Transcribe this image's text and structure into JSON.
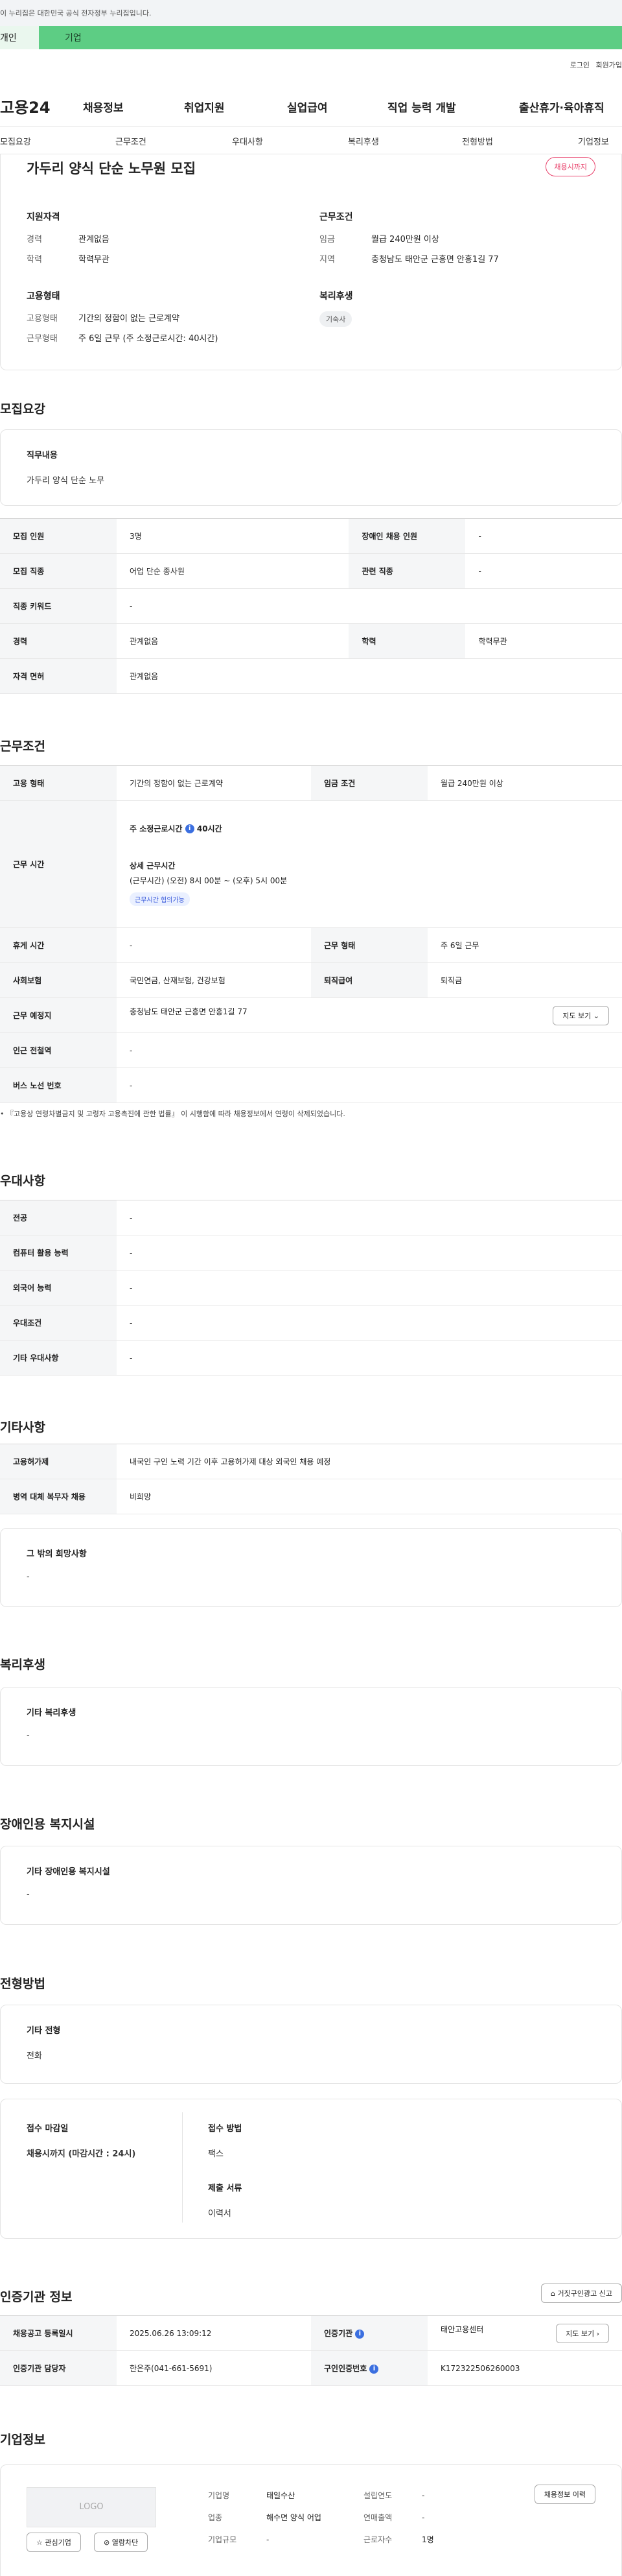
{
  "notice": "이 누리집은 대한민국 공식 전자정부 누리집입니다.",
  "tabs": {
    "personal": "개인",
    "company": "기업"
  },
  "util": {
    "login": "로그인",
    "join": "회원가입"
  },
  "gnb": {
    "logo": "고용24",
    "menu": [
      "채용정보",
      "취업지원",
      "실업급여",
      "직업 능력 개발",
      "출산휴가·육아휴직"
    ]
  },
  "subnav": [
    "모집요강",
    "근무조건",
    "우대사항",
    "복리후생",
    "전형방법",
    "기업정보"
  ],
  "header": {
    "title": "가두리 양식 단순 노무원 모집",
    "badge": "채용시까지",
    "qual_title": "지원자격",
    "qual": [
      {
        "k": "경력",
        "v": "관계없음"
      },
      {
        "k": "학력",
        "v": "학력무관"
      }
    ],
    "cond_title": "근무조건",
    "cond": [
      {
        "k": "임금",
        "v": "월급 240만원 이상"
      },
      {
        "k": "지역",
        "v": "충청남도 태안군 근흥면 안흥1길 77"
      }
    ],
    "emp_title": "고용형태",
    "emp": [
      {
        "k": "고용형태",
        "v": "기간의 정함이 없는 근로계약"
      },
      {
        "k": "근무형태",
        "v": "주 6일 근무 (주 소정근로시간: 40시간)"
      }
    ],
    "welfare_title": "복리후생",
    "welfare_tag": "기숙사"
  },
  "recruit": {
    "title": "모집요강",
    "duty_label": "직무내용",
    "duty": "가두리 양식 단순 노무",
    "rows": [
      {
        "k1": "모집 인원",
        "v1": "3명",
        "k2": "장애인 채용 인원",
        "v2": "-"
      },
      {
        "k1": "모집 직종",
        "v1": "어업 단순 종사원",
        "k2": "관련 직종",
        "v2": "-"
      },
      {
        "k1": "직종 키워드",
        "v1": "-"
      },
      {
        "k1": "경력",
        "v1": "관계없음",
        "k2": "학력",
        "v2": "학력무관"
      },
      {
        "k1": "자격 면허",
        "v1": "관계없음"
      }
    ]
  },
  "work": {
    "title": "근무조건",
    "emp_k": "고용 형태",
    "emp_v": "기간의 정함이 없는 근로계약",
    "wage_k": "임금 조건",
    "wage_v": "월급 240만원 이상",
    "time_k": "근무 시간",
    "std": "주 소정근로시간",
    "std_v": "40시간",
    "detail_t": "상세 근무시간",
    "detail_v": "(근무시간) (오전) 8시 00분 ~ (오후) 5시 00분",
    "chip": "근무시간 협의가능",
    "rest_k": "휴게 시간",
    "rest_v": "-",
    "form_k": "근무 형태",
    "form_v": "주 6일 근무",
    "ins_k": "사회보험",
    "ins_v": "국민연금, 산재보험, 건강보험",
    "ret_k": "퇴직급여",
    "ret_v": "퇴직금",
    "place_k": "근무 예정지",
    "place_v": "충청남도 태안군 근흥면 안흥1길 77",
    "map_btn": "지도 보기",
    "sub_k": "인근 전철역",
    "sub_v": "-",
    "bus_k": "버스 노선 번호",
    "bus_v": "-",
    "note": "『고용상 연령차별금지 및 고령자 고용촉진에 관한 법률』 이 시행함에 따라 채용정보에서 연령이 삭제되었습니다."
  },
  "pref": {
    "title": "우대사항",
    "rows": [
      {
        "k": "전공",
        "v": "-"
      },
      {
        "k": "컴퓨터 활용 능력",
        "v": "-"
      },
      {
        "k": "외국어 능력",
        "v": "-"
      },
      {
        "k": "우대조건",
        "v": "-"
      },
      {
        "k": "기타 우대사항",
        "v": "-"
      }
    ]
  },
  "etc": {
    "title": "기타사항",
    "rows": [
      {
        "k": "고용허가제",
        "v": "내국인 구인 노력 기간 이후 고용허가제 대상 외국인 채용 예정"
      },
      {
        "k": "병역 대체 복무자 채용",
        "v": "비희망"
      }
    ],
    "other_label": "그 밖의 희망사항",
    "other_v": "-"
  },
  "welfare": {
    "title": "복리후생",
    "label": "기타 복리후생",
    "v": "-"
  },
  "disab": {
    "title": "장애인용 복지시설",
    "label": "기타 장애인용 복지시설",
    "v": "-"
  },
  "select": {
    "title": "전형방법",
    "label": "기타 전형",
    "v": "전화",
    "deadline_t": "접수 마감일",
    "deadline_v": "채용시까지 (마감시간 : 24시)",
    "method_t": "접수 방법",
    "method_v": "팩스",
    "docs_t": "제출 서류",
    "docs_v": "이력서"
  },
  "agency": {
    "title": "인증기관 정보",
    "report_btn": "거짓구인광고 신고",
    "reg_k": "채용공고 등록일시",
    "reg_v": "2025.06.26 13:09:12",
    "org_k": "인증기관",
    "org_v": "태안고용센터",
    "map_btn": "지도 보기",
    "staff_k": "인증기관 담당자",
    "staff_v": "한은주(041-661-5691)",
    "no_k": "구인인증번호",
    "no_v": "K172322506260003"
  },
  "company": {
    "title": "기업정보",
    "logo": "LOGO",
    "fav_btn": "관심기업",
    "block_btn": "열람차단",
    "name_k": "기업명",
    "name_v": "태일수산",
    "year_k": "설립연도",
    "year_v": "-",
    "ind_k": "업종",
    "ind_v": "해수면 양식 어업",
    "sales_k": "연매출액",
    "sales_v": "-",
    "size_k": "기업규모",
    "size_v": "-",
    "emp_k": "근로자수",
    "emp_v": "1명",
    "history_btn": "채용정보 이력"
  }
}
